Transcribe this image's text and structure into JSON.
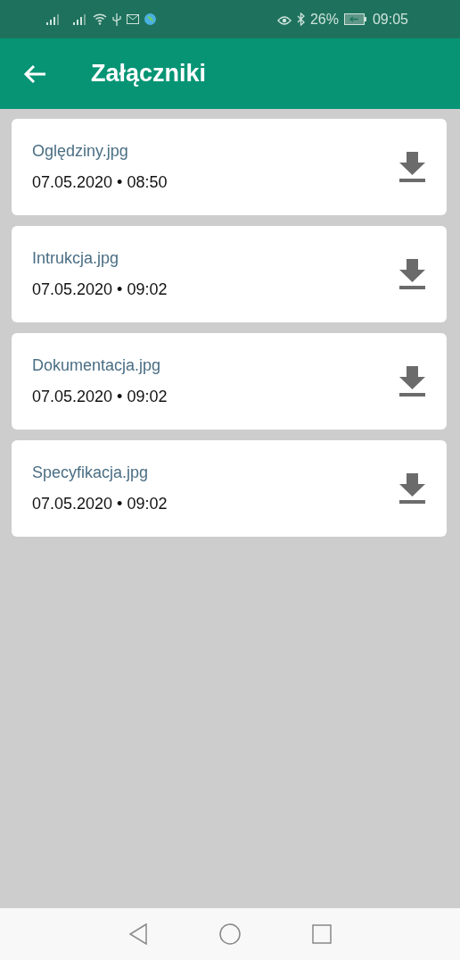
{
  "status_bar": {
    "battery": "26%",
    "time": "09:05"
  },
  "app_bar": {
    "title": "Załączniki"
  },
  "attachments": [
    {
      "name": "Oględziny.jpg",
      "date": "07.05.2020 • 08:50"
    },
    {
      "name": "Intrukcja.jpg",
      "date": "07.05.2020 • 09:02"
    },
    {
      "name": "Dokumentacja.jpg",
      "date": "07.05.2020 • 09:02"
    },
    {
      "name": "Specyfikacja.jpg",
      "date": "07.05.2020 • 09:02"
    }
  ]
}
